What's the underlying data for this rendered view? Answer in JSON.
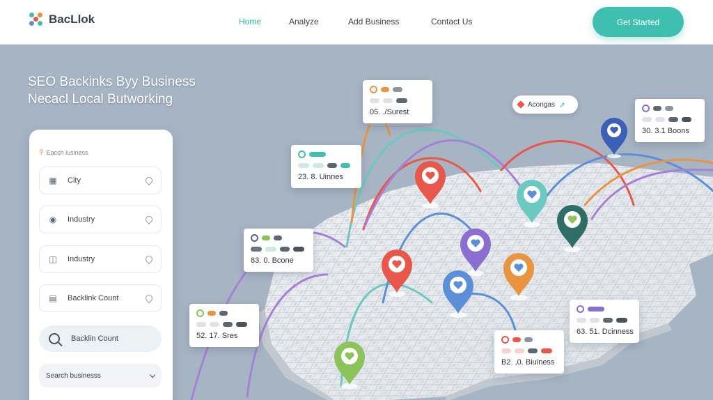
{
  "brand": {
    "name": "BacLlok"
  },
  "nav": {
    "items": [
      {
        "label": "Home",
        "active": true
      },
      {
        "label": "Analyze",
        "active": false
      },
      {
        "label": "Add Business",
        "active": false
      },
      {
        "label": "Contact Us",
        "active": false
      }
    ],
    "cta_label": "Get Started"
  },
  "hero": {
    "line1": "SEO Backinks Byy Business",
    "line2": "Necacl Local Butworking"
  },
  "panel": {
    "search_label": "Eacch lusiness",
    "fields": [
      {
        "label": "City",
        "icon": "map-icon"
      },
      {
        "label": "Industry",
        "icon": "people-icon"
      },
      {
        "label": "Industry",
        "icon": "briefcase-icon"
      },
      {
        "label": "Backlink Count",
        "icon": "calendar-icon"
      }
    ],
    "search_pill_label": "Backlin Count",
    "select_value": "Search businesss"
  },
  "map_tag": {
    "label": "Acongas"
  },
  "cards": [
    {
      "value": "05. ./Surest"
    },
    {
      "value": "23. 8. Uinnes"
    },
    {
      "value": "83. 0. Bcone"
    },
    {
      "value": "52. 17. Sres"
    },
    {
      "value": "30. 3.1 Boons"
    },
    {
      "value": "63. 51. Dcinness"
    },
    {
      "value": "B2. ,0. Biuiness"
    }
  ],
  "colors": {
    "accent": "#3fbfb0",
    "pin_red": "#e8574a",
    "pin_blue": "#5b8fd8",
    "pin_purple": "#8a6fd0",
    "pin_teal": "#6cc9c0",
    "pin_orange": "#e99440",
    "pin_green": "#8cc35a",
    "pin_navy": "#3c5fb8",
    "pin_darkteal": "#2f6e66"
  }
}
